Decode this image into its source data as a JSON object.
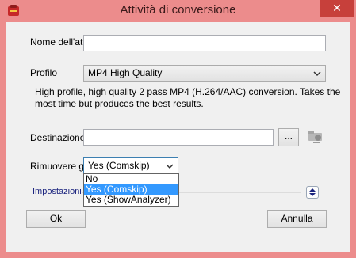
{
  "window": {
    "title": "Attività di conversione",
    "close_symbol": "✕",
    "app_icon": "toolbox-icon"
  },
  "form": {
    "name_label": "Nome dell'attività",
    "name_value": "",
    "profile_label": "Profilo",
    "profile_value": "MP4 High Quality",
    "profile_description_line1": "High profile, high quality 2 pass MP4 (H.264/AAC) conversion.  Takes the",
    "profile_description_line2": "most time but produces the best results.",
    "destination_label": "Destinazione",
    "destination_value": "",
    "browse_label": "...",
    "remove_label": "Rimuovere gli spot",
    "remove_value": "Yes (Comskip)",
    "remove_options": [
      "No",
      "Yes (Comskip)",
      "Yes (ShowAnalyzer)"
    ],
    "remove_selected_index": 1,
    "settings_label": "Impostazioni"
  },
  "buttons": {
    "ok": "Ok",
    "cancel": "Annulla"
  }
}
